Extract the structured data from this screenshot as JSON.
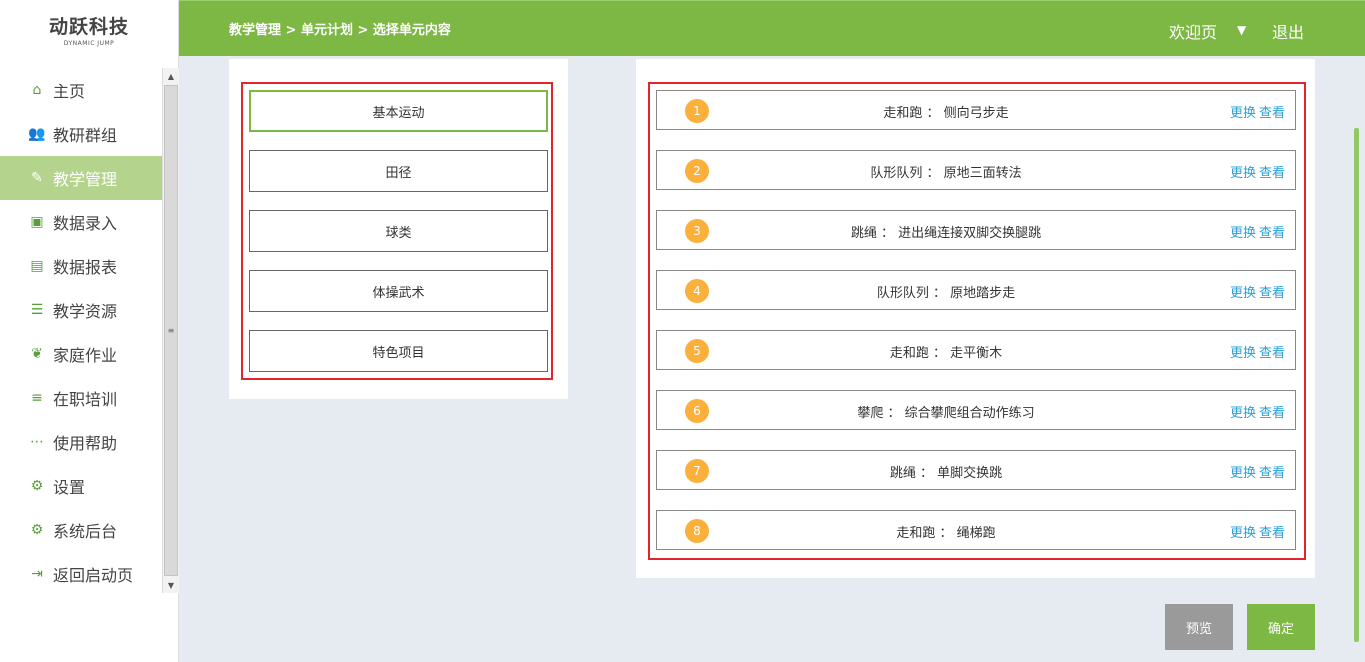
{
  "logo": {
    "main": "动跃科技",
    "sub": "DYNAMIC JUMP"
  },
  "nav": [
    {
      "label": "主页",
      "icon": "home-icon",
      "glyph": "⌂"
    },
    {
      "label": "教研群组",
      "icon": "users-icon",
      "glyph": "👥"
    },
    {
      "label": "教学管理",
      "icon": "edit-icon",
      "glyph": "✎"
    },
    {
      "label": "数据录入",
      "icon": "monitor-icon",
      "glyph": "▣"
    },
    {
      "label": "数据报表",
      "icon": "report-icon",
      "glyph": "▤"
    },
    {
      "label": "教学资源",
      "icon": "list-icon",
      "glyph": "☰"
    },
    {
      "label": "家庭作业",
      "icon": "leaf-icon",
      "glyph": "❦"
    },
    {
      "label": "在职培训",
      "icon": "training-icon",
      "glyph": "≡"
    },
    {
      "label": "使用帮助",
      "icon": "help-icon",
      "glyph": "⋯"
    },
    {
      "label": "设置",
      "icon": "gear-icon",
      "glyph": "⚙"
    },
    {
      "label": "系统后台",
      "icon": "gear-icon",
      "glyph": "⚙"
    },
    {
      "label": "返回启动页",
      "icon": "exit-icon",
      "glyph": "⇥"
    }
  ],
  "active_nav": "教学管理",
  "header": {
    "breadcrumb": "教学管理 > 单元计划 > 选择单元内容",
    "welcome": "欢迎页",
    "logout": "退出"
  },
  "categories": [
    "基本运动",
    "田径",
    "球类",
    "体操武术",
    "特色项目"
  ],
  "selected_category": "基本运动",
  "items": [
    {
      "num": "1",
      "text": "走和跑 ： 侧向弓步走"
    },
    {
      "num": "2",
      "text": "队形队列 ： 原地三面转法"
    },
    {
      "num": "3",
      "text": "跳绳 ： 进出绳连接双脚交换腿跳"
    },
    {
      "num": "4",
      "text": "队形队列 ： 原地踏步走"
    },
    {
      "num": "5",
      "text": "走和跑 ： 走平衡木"
    },
    {
      "num": "6",
      "text": "攀爬 ： 综合攀爬组合动作练习"
    },
    {
      "num": "7",
      "text": "跳绳 ： 单脚交换跳"
    },
    {
      "num": "8",
      "text": "走和跑 ： 绳梯跑"
    }
  ],
  "item_actions": {
    "replace": "更换",
    "view": "查看"
  },
  "buttons": {
    "preview": "预览",
    "confirm": "确定"
  },
  "colors": {
    "brand_green": "#7db744",
    "active_nav": "#b4d48e",
    "highlight_red": "#e0262c",
    "badge_orange": "#fbb03b",
    "link_blue": "#2a9fd6"
  }
}
